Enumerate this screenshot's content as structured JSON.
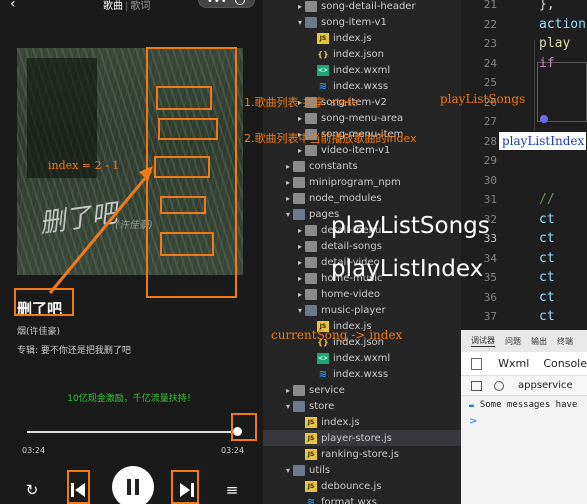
{
  "phone": {
    "back_icon": "back-icon",
    "tab_song": "歌曲",
    "tab_sep": "|",
    "tab_lyrics": "歌词",
    "capsule_dots": "•••",
    "song_title": "删了吧",
    "artist": "烟(许佳豪)",
    "album_label": "专辑: 要不你还是把我删了吧",
    "promo_text": "10亿现金激励，千亿流量扶持！",
    "current_time": "03:24",
    "total_time": "03:24",
    "progress": 1.0
  },
  "annotations": {
    "step1": "1.歌曲列表-共享",
    "step1_state": "state",
    "step1_name": "playListSongs",
    "step2": "2.歌曲列表中当前播放歌曲的index",
    "index_formula": "index = 2 - 1",
    "current_song": "currentSong",
    "current_index": "-> index",
    "big_songs": "playListSongs",
    "big_index": "playListIndex",
    "hover_box": "playListIndex"
  },
  "explorer": {
    "items": [
      {
        "label": "song-detail-header",
        "icon": "folder-icon",
        "type": "folder",
        "indent": 2,
        "caret": "▸"
      },
      {
        "label": "song-item-v1",
        "icon": "folder-icon",
        "type": "folder-open",
        "indent": 2,
        "caret": "▾"
      },
      {
        "label": "index.js",
        "icon": "js-file-icon",
        "type": "js",
        "indent": 3,
        "caret": ""
      },
      {
        "label": "index.json",
        "icon": "json-file-icon",
        "type": "json",
        "indent": 3,
        "caret": ""
      },
      {
        "label": "index.wxml",
        "icon": "wxml-file-icon",
        "type": "wxml",
        "indent": 3,
        "caret": ""
      },
      {
        "label": "index.wxss",
        "icon": "wxss-file-icon",
        "type": "wxss",
        "indent": 3,
        "caret": ""
      },
      {
        "label": "song-item-v2",
        "icon": "folder-icon",
        "type": "folder",
        "indent": 2,
        "caret": "▸"
      },
      {
        "label": "song-menu-area",
        "icon": "folder-icon",
        "type": "folder",
        "indent": 2,
        "caret": "▸"
      },
      {
        "label": "song-menu-item",
        "icon": "folder-icon",
        "type": "folder",
        "indent": 2,
        "caret": "▸"
      },
      {
        "label": "video-item-v1",
        "icon": "folder-icon",
        "type": "folder",
        "indent": 2,
        "caret": "▸"
      },
      {
        "label": "constants",
        "icon": "folder-icon",
        "type": "folder",
        "indent": 1,
        "caret": "▸"
      },
      {
        "label": "miniprogram_npm",
        "icon": "folder-icon",
        "type": "folder",
        "indent": 1,
        "caret": "▸"
      },
      {
        "label": "node_modules",
        "icon": "folder-icon",
        "type": "folder",
        "indent": 1,
        "caret": "▸"
      },
      {
        "label": "pages",
        "icon": "folder-icon",
        "type": "folder-open",
        "indent": 1,
        "caret": "▾"
      },
      {
        "label": "detail-menu",
        "icon": "folder-icon",
        "type": "folder",
        "indent": 2,
        "caret": "▸"
      },
      {
        "label": "detail-songs",
        "icon": "folder-icon",
        "type": "folder",
        "indent": 2,
        "caret": "▸"
      },
      {
        "label": "detail-video",
        "icon": "folder-icon",
        "type": "folder",
        "indent": 2,
        "caret": "▸"
      },
      {
        "label": "home-music",
        "icon": "folder-icon",
        "type": "folder",
        "indent": 2,
        "caret": "▸"
      },
      {
        "label": "home-video",
        "icon": "folder-icon",
        "type": "folder",
        "indent": 2,
        "caret": "▸"
      },
      {
        "label": "music-player",
        "icon": "folder-icon",
        "type": "folder-open",
        "indent": 2,
        "caret": "▾"
      },
      {
        "label": "index.js",
        "icon": "js-file-icon",
        "type": "js",
        "indent": 3,
        "caret": ""
      },
      {
        "label": "index.json",
        "icon": "json-file-icon",
        "type": "json",
        "indent": 3,
        "caret": ""
      },
      {
        "label": "index.wxml",
        "icon": "wxml-file-icon",
        "type": "wxml",
        "indent": 3,
        "caret": ""
      },
      {
        "label": "index.wxss",
        "icon": "wxss-file-icon",
        "type": "wxss",
        "indent": 3,
        "caret": ""
      },
      {
        "label": "service",
        "icon": "folder-icon",
        "type": "folder",
        "indent": 1,
        "caret": "▸"
      },
      {
        "label": "store",
        "icon": "folder-icon",
        "type": "folder-open",
        "indent": 1,
        "caret": "▾"
      },
      {
        "label": "index.js",
        "icon": "js-file-icon",
        "type": "js",
        "indent": 2,
        "caret": ""
      },
      {
        "label": "player-store.js",
        "icon": "js-file-icon",
        "type": "js",
        "indent": 2,
        "caret": "",
        "selected": true
      },
      {
        "label": "ranking-store.js",
        "icon": "js-file-icon",
        "type": "js",
        "indent": 2,
        "caret": ""
      },
      {
        "label": "utils",
        "icon": "folder-icon",
        "type": "folder-open",
        "indent": 1,
        "caret": "▾"
      },
      {
        "label": "debounce.js",
        "icon": "js-file-icon",
        "type": "js",
        "indent": 2,
        "caret": ""
      },
      {
        "label": "format.wxs",
        "icon": "wxs-file-icon",
        "type": "wxs",
        "indent": 2,
        "caret": ""
      }
    ]
  },
  "code": {
    "lines": [
      {
        "num": "21",
        "text": "},",
        "color": "#d4d4d4"
      },
      {
        "num": "22",
        "text": "action",
        "color": "#9cdcfe"
      },
      {
        "num": "23",
        "text": "play",
        "color": "#dcdcaa"
      },
      {
        "num": "24",
        "text": "  if",
        "color": "#c586c0"
      },
      {
        "num": "25",
        "text": "",
        "color": "#d4d4d4"
      },
      {
        "num": "26",
        "text": "",
        "color": "#d4d4d4"
      },
      {
        "num": "27",
        "text": "",
        "color": "#d4d4d4"
      },
      {
        "num": "28",
        "text": "  }",
        "color": "#d4d4d4"
      },
      {
        "num": "29",
        "text": "",
        "color": "#d4d4d4"
      },
      {
        "num": "30",
        "text": "",
        "color": "#d4d4d4"
      },
      {
        "num": "31",
        "text": "  //",
        "color": "#6a9955"
      },
      {
        "num": "32",
        "text": "  ct",
        "color": "#9cdcfe"
      },
      {
        "num": "33",
        "text": "  ct",
        "color": "#9cdcfe"
      },
      {
        "num": "34",
        "text": "  ct",
        "color": "#9cdcfe"
      },
      {
        "num": "35",
        "text": "  ct",
        "color": "#9cdcfe"
      },
      {
        "num": "36",
        "text": "  ct",
        "color": "#9cdcfe"
      },
      {
        "num": "37",
        "text": "  ct",
        "color": "#9cdcfe"
      },
      {
        "num": "38",
        "text": "  ct",
        "color": "#9cdcfe"
      }
    ]
  },
  "debug": {
    "tab_debugger": "调试器",
    "tab_issues": "问题",
    "tab_output": "输出",
    "tab_terminal": "终端",
    "tab_wxml": "Wxml",
    "tab_console": "Console",
    "context": "appservice",
    "message": "Some messages have",
    "prompt": ">"
  },
  "colors": {
    "annotation": "#f07a15",
    "promo": "#35c735",
    "selection": "#37373d"
  }
}
